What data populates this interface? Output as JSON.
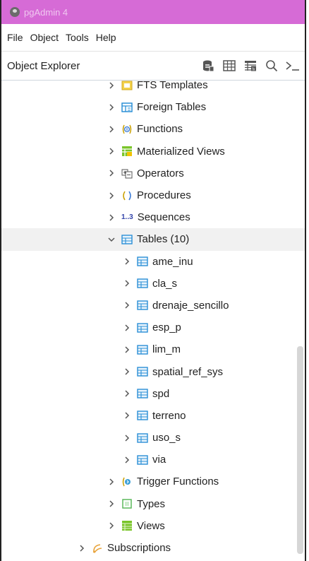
{
  "app": {
    "title": "pgAdmin 4"
  },
  "menu": [
    "File",
    "Object",
    "Tools",
    "Help"
  ],
  "panel": {
    "title": "Object Explorer",
    "toolbar": [
      "query-tool-icon",
      "view-data-icon",
      "filtered-rows-icon",
      "search-objects-icon",
      "psql-tool-icon"
    ]
  },
  "tree": {
    "fts_templates": "FTS Templates",
    "foreign_tables": "Foreign Tables",
    "functions": "Functions",
    "materialized_views": "Materialized Views",
    "operators": "Operators",
    "procedures": "Procedures",
    "sequences_icon": "1..3",
    "sequences": "Sequences",
    "tables": "Tables (10)",
    "table_items": [
      "ame_inu",
      "cla_s",
      "drenaje_sencillo",
      "esp_p",
      "lim_m",
      "spatial_ref_sys",
      "spd",
      "terreno",
      "uso_s",
      "via"
    ],
    "trigger_functions": "Trigger Functions",
    "types": "Types",
    "views": "Views",
    "subscriptions": "Subscriptions"
  },
  "colors": {
    "titlebar": "#d66bd6",
    "table_icon": "#2a8fd6",
    "view_icon": "#7ac52a"
  }
}
